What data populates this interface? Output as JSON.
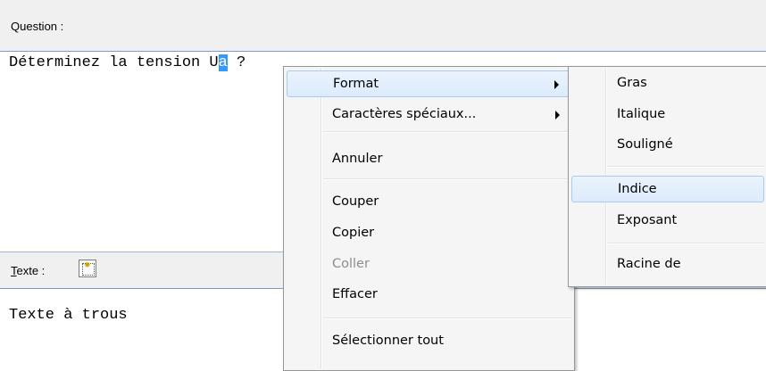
{
  "question": {
    "label": "Question :",
    "text_before": "Déterminez la tension U",
    "text_selected": "a",
    "text_after": " ?"
  },
  "texte": {
    "label_first": "T",
    "label_rest": "exte :",
    "value": "Texte à trous",
    "icon": "new-document-icon"
  },
  "context_menu": {
    "items": [
      {
        "label": "Format"
      },
      {
        "label": "Caractères spéciaux..."
      },
      {
        "label": "Annuler"
      },
      {
        "label": "Couper"
      },
      {
        "label": "Copier"
      },
      {
        "label": "Coller"
      },
      {
        "label": "Effacer"
      },
      {
        "label": "Sélectionner tout"
      }
    ]
  },
  "format_submenu": {
    "items": [
      {
        "label": "Gras"
      },
      {
        "label": "Italique"
      },
      {
        "label": "Souligné"
      },
      {
        "label": "Indice"
      },
      {
        "label": "Exposant"
      },
      {
        "label": "Racine de"
      }
    ]
  },
  "colors": {
    "selection": "#3399ff",
    "highlight_border": "#a8cbee",
    "menu_bg": "#f5f5f5"
  }
}
